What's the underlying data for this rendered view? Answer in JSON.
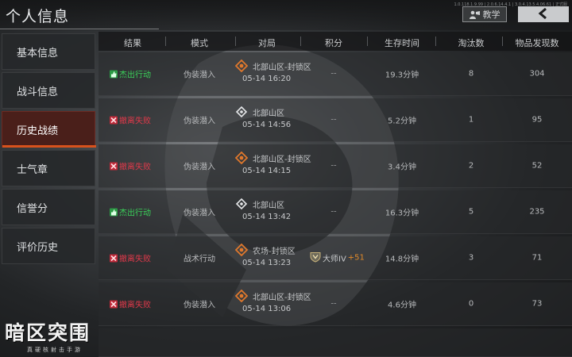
{
  "header": {
    "title": "个人信息",
    "build_info": "1.0.118.1.9.99 | 2.0.6.14.4.1 | 3.0.4.13.5.4.06.61 | 正式服",
    "tutorial_label": "教学"
  },
  "sidebar": {
    "items": [
      {
        "label": "基本信息"
      },
      {
        "label": "战斗信息"
      },
      {
        "label": "历史战绩"
      },
      {
        "label": "士气章"
      },
      {
        "label": "信誉分"
      },
      {
        "label": "评价历史"
      }
    ],
    "active_index": 2
  },
  "table": {
    "columns": [
      "结果",
      "模式",
      "对局",
      "积分",
      "生存时间",
      "淘汰数",
      "物品发现数"
    ],
    "rows": [
      {
        "result": "杰出行动",
        "result_type": "win",
        "mode": "伪装潜入",
        "map": "北部山区-封锁区",
        "map_icon": "lockdown-zone-icon",
        "time": "05-14 16:20",
        "score": "--",
        "survival": "19.3分钟",
        "kills": "8",
        "items": "304"
      },
      {
        "result": "撤离失败",
        "result_type": "lose",
        "mode": "伪装潜入",
        "map": "北部山区",
        "map_icon": "normal-zone-icon",
        "time": "05-14 14:56",
        "score": "--",
        "survival": "5.2分钟",
        "kills": "1",
        "items": "95"
      },
      {
        "result": "撤离失败",
        "result_type": "lose",
        "mode": "伪装潜入",
        "map": "北部山区-封锁区",
        "map_icon": "lockdown-zone-icon",
        "time": "05-14 14:15",
        "score": "--",
        "survival": "3.4分钟",
        "kills": "2",
        "items": "52"
      },
      {
        "result": "杰出行动",
        "result_type": "win",
        "mode": "伪装潜入",
        "map": "北部山区",
        "map_icon": "normal-zone-icon",
        "time": "05-14 13:42",
        "score": "--",
        "survival": "16.3分钟",
        "kills": "5",
        "items": "235"
      },
      {
        "result": "撤离失败",
        "result_type": "lose",
        "mode": "战术行动",
        "map": "农场-封锁区",
        "map_icon": "lockdown-zone-icon",
        "time": "05-14 13:23",
        "score": "",
        "rank_name": "大师IV",
        "rank_delta": "+51",
        "survival": "14.8分钟",
        "kills": "3",
        "items": "71"
      },
      {
        "result": "撤离失败",
        "result_type": "lose",
        "mode": "伪装潜入",
        "map": "北部山区-封锁区",
        "map_icon": "lockdown-zone-icon",
        "time": "05-14 13:06",
        "score": "--",
        "survival": "4.6分钟",
        "kills": "0",
        "items": "73"
      }
    ]
  },
  "logo": {
    "main": "暗区突围",
    "sub": "真硬核射击手游"
  },
  "colors": {
    "win": "#3bd35a",
    "lose": "#e0394a",
    "active_tab": "#4a1f1a",
    "accent_orange": "#d8521c",
    "rank_delta": "#e08a2a"
  }
}
